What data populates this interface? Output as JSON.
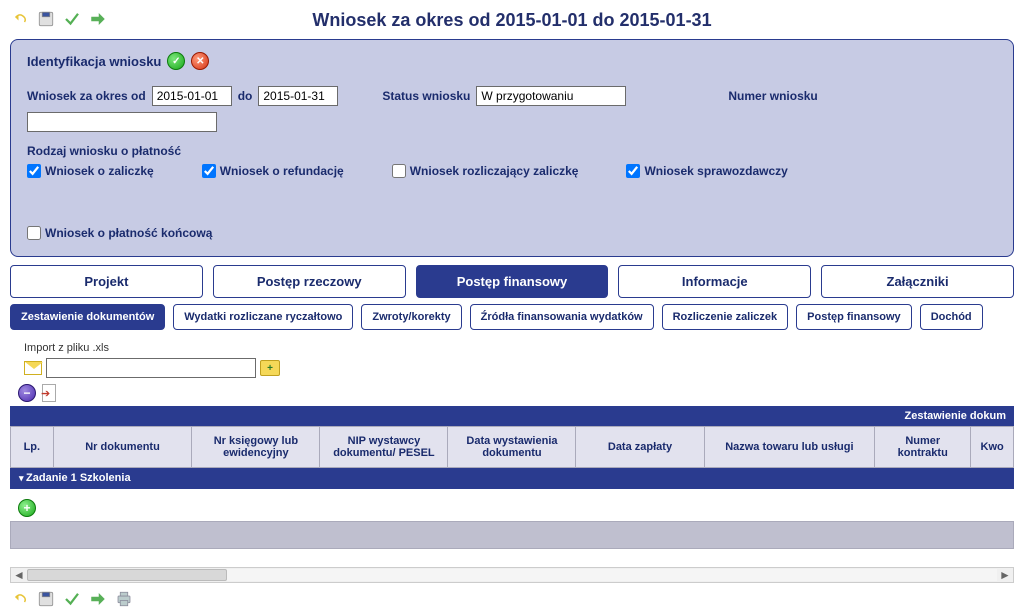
{
  "header": {
    "page_title": "Wniosek za okres od 2015-01-01 do 2015-01-31"
  },
  "ident_panel": {
    "title": "Identyfikacja wniosku",
    "date_from_label": "Wniosek za okres od",
    "date_from": "2015-01-01",
    "date_to_label": "do",
    "date_to": "2015-01-31",
    "status_label": "Status wniosku",
    "status_value": "W przygotowaniu",
    "number_label": "Numer wniosku",
    "number_value": "",
    "type_section_label": "Rodzaj wniosku o płatność",
    "checks": [
      {
        "label": "Wniosek o zaliczkę",
        "checked": true
      },
      {
        "label": "Wniosek o refundację",
        "checked": true
      },
      {
        "label": "Wniosek rozliczający zaliczkę",
        "checked": false
      },
      {
        "label": "Wniosek sprawozdawczy",
        "checked": true
      },
      {
        "label": "Wniosek o płatność końcową",
        "checked": false
      }
    ]
  },
  "main_tabs": [
    {
      "label": "Projekt",
      "active": false
    },
    {
      "label": "Postęp rzeczowy",
      "active": false
    },
    {
      "label": "Postęp finansowy",
      "active": true
    },
    {
      "label": "Informacje",
      "active": false
    },
    {
      "label": "Załączniki",
      "active": false
    }
  ],
  "sub_tabs": [
    {
      "label": "Zestawienie dokumentów",
      "active": true
    },
    {
      "label": "Wydatki rozliczane ryczałtowo",
      "active": false
    },
    {
      "label": "Zwroty/korekty",
      "active": false
    },
    {
      "label": "Źródła finansowania wydatków",
      "active": false
    },
    {
      "label": "Rozliczenie zaliczek",
      "active": false
    },
    {
      "label": "Postęp finansowy",
      "active": false
    },
    {
      "label": "Dochód",
      "active": false
    }
  ],
  "import": {
    "label": "Import z pliku .xls",
    "file_value": ""
  },
  "table": {
    "banner": "Zestawienie dokum",
    "columns": [
      "Lp.",
      "Nr dokumentu",
      "Nr księgowy lub ewidencyjny",
      "NIP wystawcy dokumentu/ PESEL",
      "Data wystawienia dokumentu",
      "Data zapłaty",
      "Nazwa towaru lub usługi",
      "Numer kontraktu",
      "Kwo"
    ],
    "group_row": "Zadanie 1 Szkolenia"
  }
}
